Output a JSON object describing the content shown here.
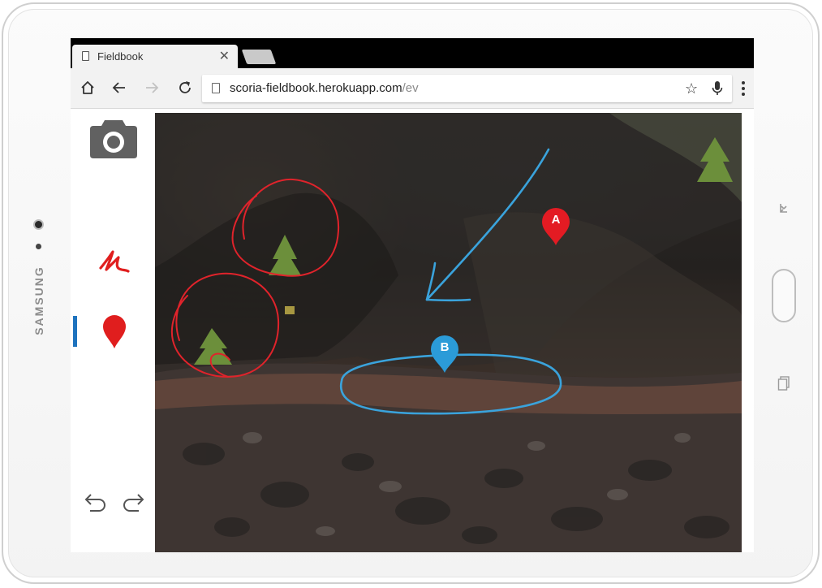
{
  "device": {
    "brand": "SAMSUNG"
  },
  "browser": {
    "tab": {
      "title": "Fieldbook",
      "close_icon": "close-icon"
    },
    "toolbar": {
      "home_icon": "home-icon",
      "back_icon": "arrow-left-icon",
      "forward_icon": "arrow-right-icon",
      "reload_icon": "reload-icon",
      "url_host": "scoria-fieldbook.herokuapp.com",
      "url_path": "/ev",
      "star_icon": "star-icon",
      "mic_icon": "microphone-icon",
      "menu_icon": "more-vert-icon"
    }
  },
  "sidebar": {
    "tools": [
      {
        "name": "camera",
        "icon": "camera-icon",
        "color": "#5f6368"
      },
      {
        "name": "draw",
        "icon": "scribble-icon",
        "color": "#e01e1e"
      },
      {
        "name": "pin",
        "icon": "map-pin-icon",
        "color": "#e01e1e",
        "active": true
      }
    ],
    "active_color": "#1e73be",
    "undo_icon": "undo-icon",
    "redo_icon": "redo-icon"
  },
  "annotations": {
    "pins": [
      {
        "label": "A",
        "color": "#e31b23"
      },
      {
        "label": "B",
        "color": "#2b9bd8"
      }
    ],
    "red_stroke_color": "#e0232b",
    "blue_stroke_color": "#3aa3dc"
  }
}
